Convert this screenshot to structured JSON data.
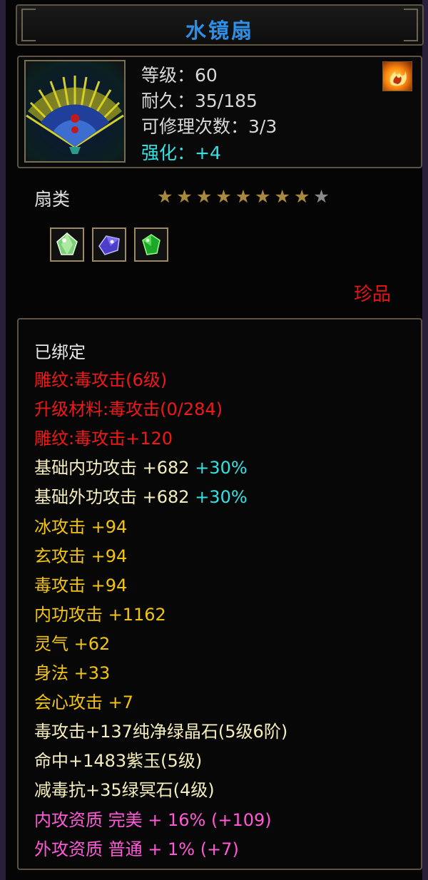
{
  "item": {
    "name": "水镜扇",
    "stats": {
      "level": "等级：60",
      "durability": "耐久：35/185",
      "repairs": "可修理次数：3/3",
      "enhance": "强化：+4"
    },
    "category": "扇类",
    "stars": {
      "filled": 8,
      "total": 9
    },
    "gems": [
      "green-crystal-icon",
      "purple-crystal-icon",
      "green-gem-icon"
    ],
    "rarity": "珍品",
    "corner_icon": "flame-icon"
  },
  "attributes": {
    "bound": "已绑定",
    "engrave1": "雕纹:毒攻击(6级)",
    "upgrade": "升级材料:毒攻击(0/284)",
    "engrave2": "雕纹:毒攻击+120",
    "base_inner": {
      "label": "基础内功攻击 +682 ",
      "bonus": "+30%"
    },
    "base_outer": {
      "label": "基础外功攻击 +682 ",
      "bonus": "+30%"
    },
    "ice": "冰攻击 +94",
    "xuan": "玄攻击 +94",
    "poison": "毒攻击 +94",
    "inner_attack": "内功攻击 +1162",
    "spirit": "灵气 +62",
    "agility": "身法 +33",
    "crit": "会心攻击 +7",
    "socket1": "毒攻击+137纯净绿晶石(5级6阶)",
    "socket2": "命中+1483紫玉(5级)",
    "socket3": "减毒抗+35绿冥石(4级)",
    "quality_inner": "内攻资质 完美 + 16% (+109)",
    "quality_outer": "外攻资质 普通 + 1% (+7)"
  },
  "colors": {
    "title": "#2e8fe6",
    "red": "#f01818",
    "gold": "#f2c40e",
    "pink": "#ff5ad6",
    "cyan": "#33e2e2",
    "cream": "#f5eebc"
  }
}
